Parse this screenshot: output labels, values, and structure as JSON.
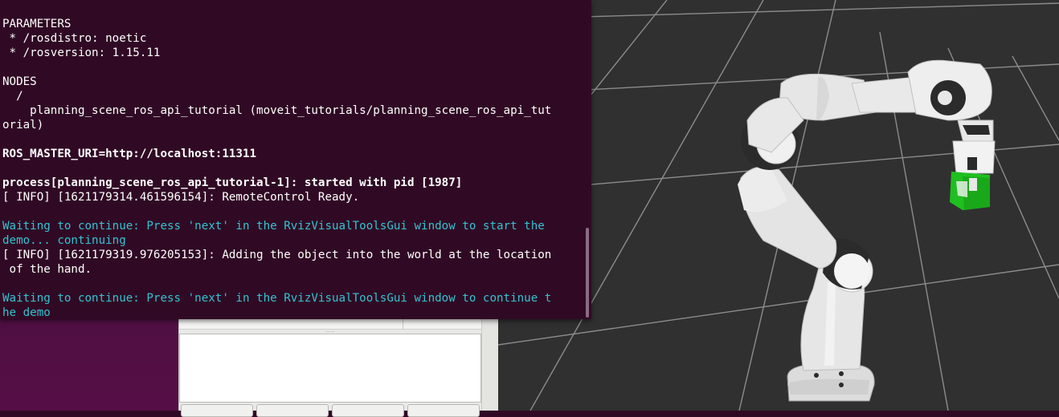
{
  "terminal": {
    "lines": [
      {
        "text": "PARAMETERS",
        "style": "normal"
      },
      {
        "text": " * /rosdistro: noetic",
        "style": "normal"
      },
      {
        "text": " * /rosversion: 1.15.11",
        "style": "normal"
      },
      {
        "text": "",
        "style": "normal"
      },
      {
        "text": "NODES",
        "style": "normal"
      },
      {
        "text": "  /",
        "style": "normal"
      },
      {
        "text": "    planning_scene_ros_api_tutorial (moveit_tutorials/planning_scene_ros_api_tut",
        "style": "normal"
      },
      {
        "text": "orial)",
        "style": "normal"
      },
      {
        "text": "",
        "style": "normal"
      },
      {
        "text": "ROS_MASTER_URI=http://localhost:11311",
        "style": "bold"
      },
      {
        "text": "",
        "style": "normal"
      },
      {
        "text": "process[planning_scene_ros_api_tutorial-1]: started with pid [1987]",
        "style": "bold"
      },
      {
        "text": "[ INFO] [1621179314.461596154]: RemoteControl Ready.",
        "style": "normal"
      },
      {
        "text": "",
        "style": "normal"
      },
      {
        "text": "Waiting to continue: Press 'next' in the RvizVisualToolsGui window to start the",
        "style": "cyan"
      },
      {
        "text": "demo... continuing",
        "style": "cyan"
      },
      {
        "text": "[ INFO] [1621179319.976205153]: Adding the object into the world at the location",
        "style": "normal"
      },
      {
        "text": " of the hand.",
        "style": "normal"
      },
      {
        "text": "",
        "style": "normal"
      },
      {
        "text": "Waiting to continue: Press 'next' in the RvizVisualToolsGui window to continue t",
        "style": "cyan"
      },
      {
        "text": "he demo",
        "style": "cyan"
      }
    ]
  },
  "rviz": {
    "panel_handle": "......",
    "colors": {
      "background": "#303030",
      "grid": "#8c8c8c",
      "robot_white": "#e6e6e6",
      "robot_dark": "#2b2b2b",
      "object": "#1fbf1f"
    }
  }
}
